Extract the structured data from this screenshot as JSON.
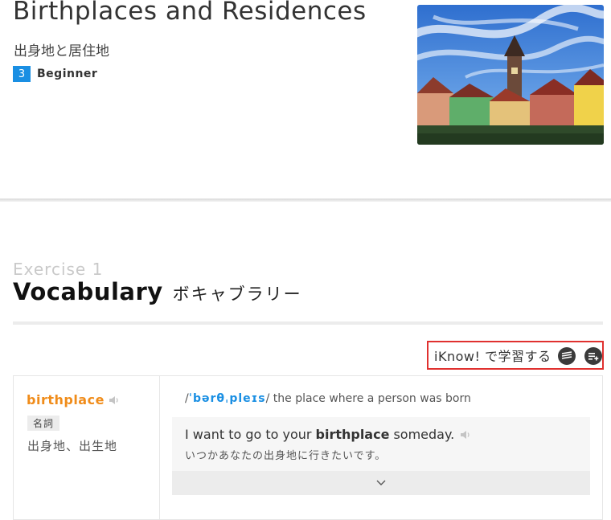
{
  "lesson": {
    "title": "Birthplaces and Residences",
    "subtitle": "出身地と居住地",
    "level_number": "3",
    "level_label": "Beginner",
    "image_icon": "town-photo"
  },
  "exercise": {
    "label": "Exercise 1",
    "title_en": "Vocabulary",
    "title_jp": "ボキャブラリー"
  },
  "iknow": {
    "label": "iKnow! で学習する",
    "icons": [
      "iknow-study-icon",
      "iknow-add-list-icon"
    ]
  },
  "vocab": {
    "word": "birthplace",
    "part_of_speech": "名詞",
    "translation": "出身地、出生地",
    "pronunciation": "ˈbərθˌpleɪs",
    "definition": "the place where a person was born",
    "example_before": "I want to go to your",
    "example_word": "birthplace",
    "example_after": "someday.",
    "example_translation": "いつかあなたの出身地に行きたいです。"
  },
  "colors": {
    "accent_blue": "#1a8fe3",
    "word_orange": "#f08c1a",
    "highlight_red": "#e0312f"
  }
}
